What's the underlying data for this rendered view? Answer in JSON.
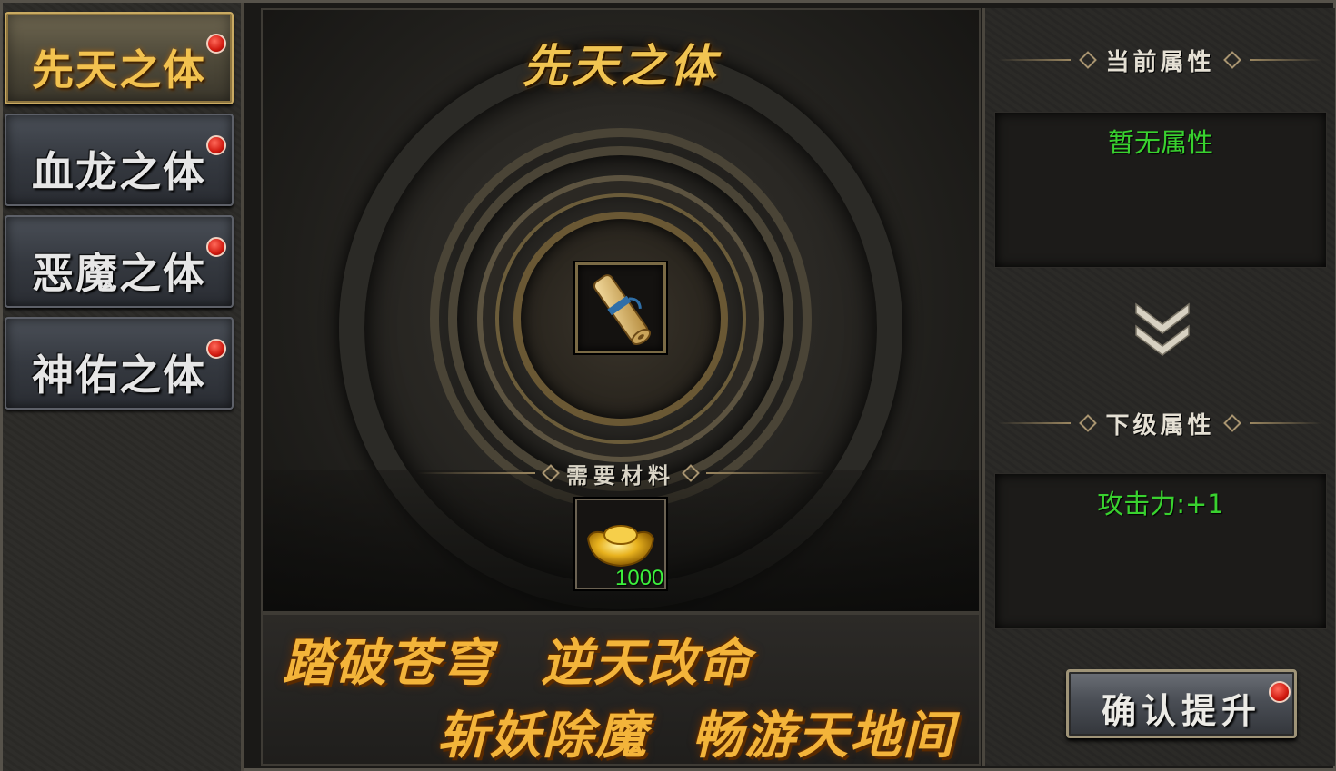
{
  "sidebar": {
    "items": [
      {
        "label": "先天之体",
        "active": true,
        "has_alert": true
      },
      {
        "label": "血龙之体",
        "active": false,
        "has_alert": true
      },
      {
        "label": "恶魔之体",
        "active": false,
        "has_alert": true
      },
      {
        "label": "神佑之体",
        "active": false,
        "has_alert": true
      }
    ]
  },
  "center": {
    "title": "先天之体",
    "item_icon": "scroll-icon",
    "materials": {
      "heading": "需要材料",
      "item_icon": "gold-ingot-icon",
      "count": "1000"
    }
  },
  "banner": {
    "line1_left": "踏破苍穹",
    "line1_right": "逆天改命",
    "line2_left": "斩妖除魔",
    "line2_right": "畅游天地间"
  },
  "attributes": {
    "current_heading": "当前属性",
    "current_value": "暂无属性",
    "next_heading": "下级属性",
    "next_value": "攻击力:+1"
  },
  "confirm_button": {
    "label": "确认提升",
    "has_alert": true
  },
  "colors": {
    "accent_gold": "#f1c451",
    "attr_green": "#39d12f",
    "count_green": "#3cf03c",
    "alert_red": "#d11a10"
  }
}
